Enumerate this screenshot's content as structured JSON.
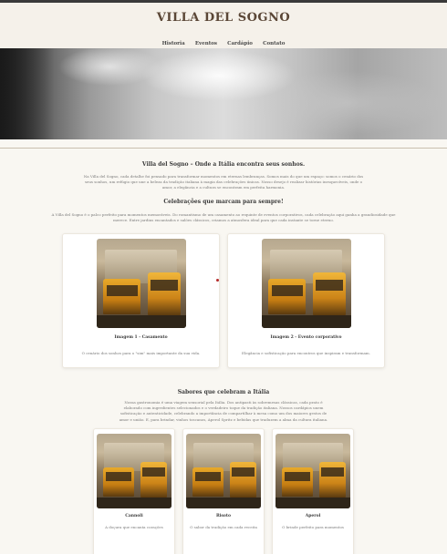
{
  "header": {
    "title": "VILLA DEL SOGNO",
    "nav": [
      "Historia",
      "Eventos",
      "Cardápio",
      "Contato"
    ]
  },
  "intro": {
    "heading": "Villa del Sogno – Onde a Itália encontra seus sonhos.",
    "text": "Na Villa del Sogno, cada detalhe foi pensado para transformar momentos em eternas lembranças. Somos mais do que um espaço: somos o cenário dos seus sonhos, um refúgio que une a beleza da tradição italiana à magia das celebrações únicas. Nosso desejo é realizar histórias inesquecíveis, onde o amor, a elegância e a cultura se encontram em perfeita harmonia."
  },
  "celebrations": {
    "heading": "Celebrações que marcam para sempre!",
    "text": "A Villa del Sogno é o palco perfeito para momentos memoráveis. Do romantismo de um casamento ao requinte de eventos corporativos, cada celebração aqui ganha a grandiosidade que merece. Entre jardins encantados e salões clássicos, criamos a atmosfera ideal para que cada instante se torne eterno.",
    "cards": [
      {
        "caption": "Imagem 1 - Casamento",
        "desc": "O cenário dos sonhos para o \"sim\" mais importante da sua vida."
      },
      {
        "caption": "Imagem 2 - Evento corporativo",
        "desc": "Elegância e sofisticação para encontros que inspiram e transformam."
      }
    ]
  },
  "flavors": {
    "heading": "Sabores que celebram a Itália",
    "text": "Nossa gastronomia é uma viagem sensorial pela Itália. Dos antipasti às sobremesas clássicas, cada prato é elaborado com ingredientes selecionados e o verdadeiro toque da tradição italiana. Nossos cardápios unem sofisticação e autenticidade, celebrando a importância de compartilhar à mesa como um dos maiores gestos de amor e união. E, para brindar, vinhos toscanos, Aperol Spritz e bebidas que traduzem a alma da cultura italiana.",
    "cards": [
      {
        "caption": "Cannoli",
        "desc": "A doçura que encanta corações"
      },
      {
        "caption": "Risoto",
        "desc": "O sabor da tradição em cada receita"
      },
      {
        "caption": "Aperol",
        "desc": "O brinde perfeito para momentos"
      }
    ]
  }
}
